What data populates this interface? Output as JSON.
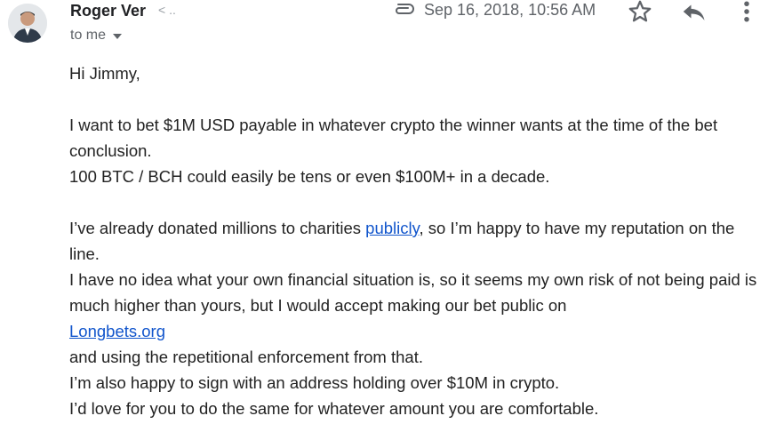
{
  "sender": {
    "name": "Roger Ver",
    "address_fragment": "< .."
  },
  "recipient": {
    "label": "to me"
  },
  "meta": {
    "date": "Sep 16, 2018, 10:56 AM",
    "icons": [
      "avatar",
      "paperclip-icon",
      "star-icon",
      "reply-icon",
      "more-vert-icon"
    ]
  },
  "message": {
    "greeting": "Hi Jimmy,",
    "p1_line1": "I want to bet $1M USD payable in whatever crypto the winner wants at the time of the bet conclusion.",
    "p1_line2": "100 BTC / BCH could easily be tens or even $100M+ in a decade.",
    "p2_before_link": "I’ve already donated millions to charities ",
    "p2_link": "publicly",
    "p2_after_link": ",  so I’m happy to have my reputation on the line.",
    "p3_line1": "I have no idea what your own financial situation is, so it seems my own risk of not being paid is much higher than yours, but I would accept making our bet public on",
    "p3_link": "Longbets.org",
    "p3_line2": "and using the repetitional enforcement from that.",
    "p3_line3": "I’m also happy to sign with an address holding over $10M in crypto.",
    "p3_line4": "I’d love for you to do the same for whatever amount you are comfortable."
  },
  "colors": {
    "link": "#1155cc",
    "meta_text": "#5f6368",
    "body_text": "#222222"
  }
}
